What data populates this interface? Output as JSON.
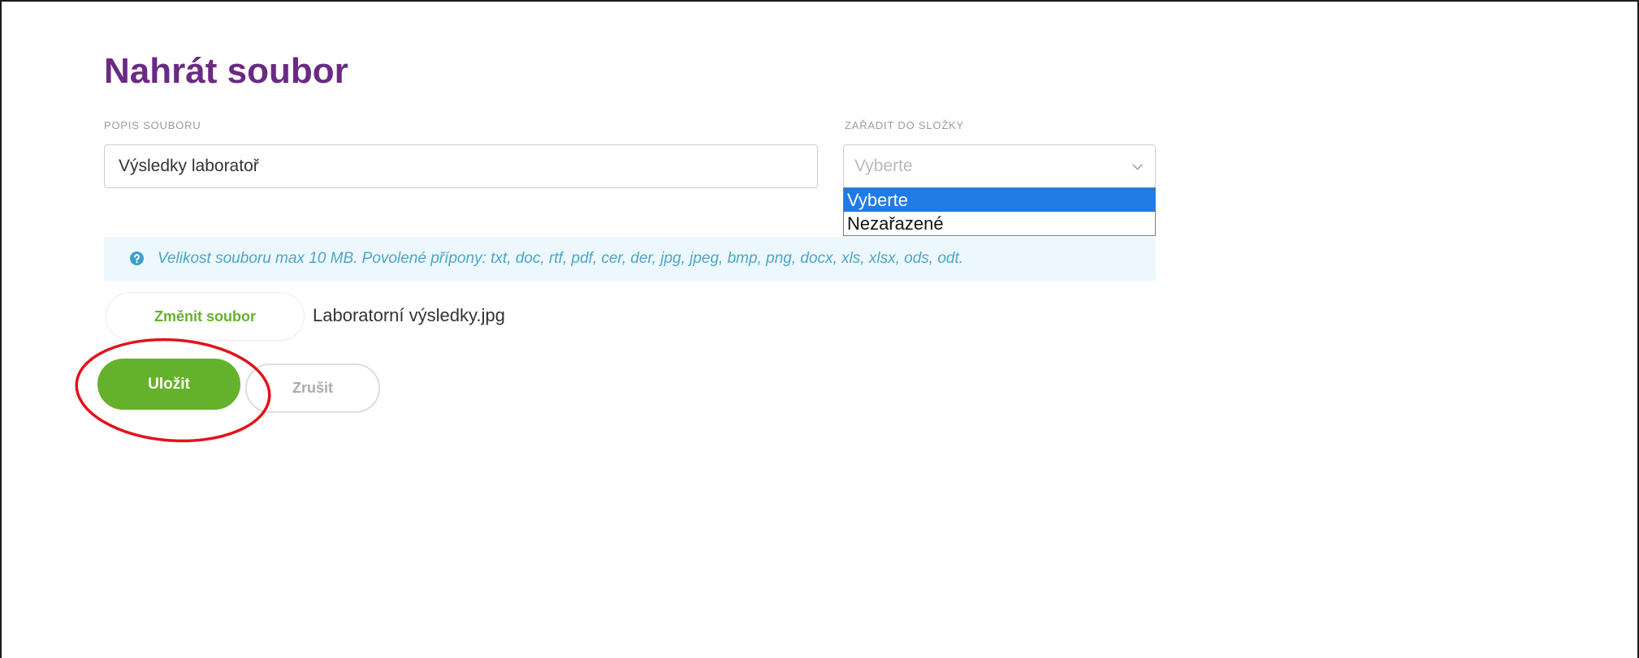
{
  "page": {
    "title": "Nahrát soubor"
  },
  "form": {
    "description": {
      "label": "POPIS SOUBORU",
      "value": "Výsledky laboratoř"
    },
    "folder": {
      "label": "ZAŘADIT DO SLOŽKY",
      "selected": "Vyberte",
      "icon": "chevron-down-icon",
      "dropdown_open": true,
      "highlighted_index": 0,
      "options": [
        {
          "label": "Vyberte"
        },
        {
          "label": "Nezařazené"
        }
      ]
    },
    "info": {
      "icon": "question-circle-icon",
      "text": "Velikost souboru max 10 MB. Povolené přípony: txt, doc, rtf, pdf, cer, der, jpg, jpeg, bmp, png, docx, xls, xlsx, ods, odt."
    },
    "file": {
      "change_button_label": "Změnit soubor",
      "filename": "Laboratorní výsledky.jpg"
    },
    "actions": {
      "save_label": "Uložit",
      "cancel_label": "Zrušit"
    }
  },
  "annotation": {
    "color": "#e3121b"
  },
  "theme": {
    "accent": "#6a2a84",
    "green": "#64b22b",
    "info_bg": "#ecf8fd",
    "info_text": "#4ea5c9",
    "info_icon": "#3e9ecb",
    "option_highlight": "#1f7be5"
  }
}
